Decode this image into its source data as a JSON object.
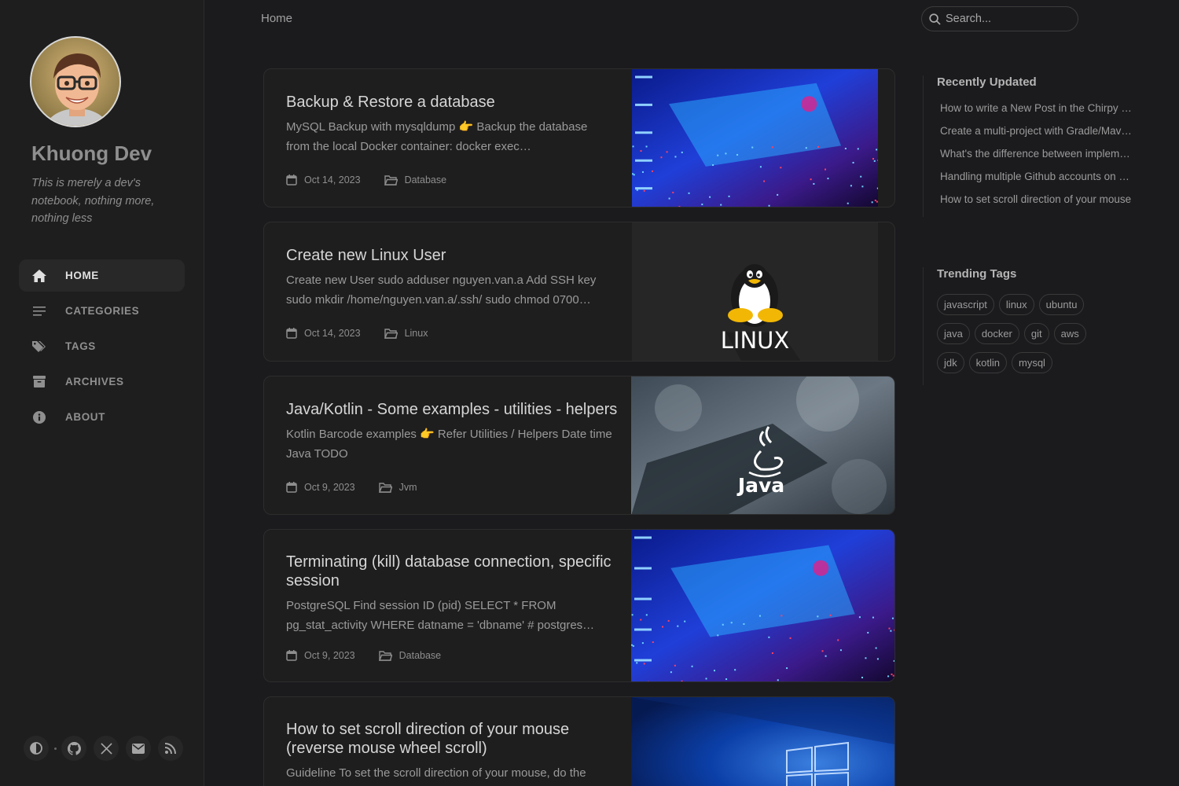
{
  "sidebar": {
    "title": "Khuong Dev",
    "subtitle": "This is merely a dev's notebook, nothing more, nothing less",
    "nav": [
      {
        "label": "HOME",
        "icon": "home-icon"
      },
      {
        "label": "CATEGORIES",
        "icon": "list-icon"
      },
      {
        "label": "TAGS",
        "icon": "tags-icon"
      },
      {
        "label": "ARCHIVES",
        "icon": "archive-icon"
      },
      {
        "label": "ABOUT",
        "icon": "info-icon"
      }
    ],
    "bottom_icons": [
      "theme-toggle-icon",
      "github-icon",
      "x-twitter-icon",
      "email-icon",
      "rss-icon"
    ]
  },
  "topbar": {
    "breadcrumb": "Home",
    "search_placeholder": "Search..."
  },
  "posts": [
    {
      "title": "Backup & Restore a database",
      "excerpt": "MySQL Backup with mysqldump 👉 Backup the database from the local Docker container: docker exec…",
      "date": "Oct 14, 2023",
      "category": "Database",
      "image": "sql-image"
    },
    {
      "title": "Create new Linux User",
      "excerpt": "Create new User sudo adduser nguyen.van.a Add SSH key sudo mkdir /home/nguyen.van.a/.ssh/ sudo chmod 0700…",
      "date": "Oct 14, 2023",
      "category": "Linux",
      "image": "linux-image",
      "image_caption": "LINUX"
    },
    {
      "title": "Java/Kotlin - Some examples - utilities - helpers",
      "excerpt": "Kotlin Barcode examples 👉 Refer Utilities / Helpers Date time Java TODO",
      "date": "Oct 9, 2023",
      "category": "Jvm",
      "image": "java-image",
      "image_caption": "Java"
    },
    {
      "title": "Terminating (kill) database connection, specific session",
      "excerpt": "PostgreSQL Find session ID (pid) SELECT * FROM pg_stat_activity WHERE datname = 'dbname' # postgres…",
      "date": "Oct 9, 2023",
      "category": "Database",
      "image": "sql-image"
    },
    {
      "title": "How to set scroll direction of your mouse (reverse mouse wheel scroll)",
      "excerpt": "Guideline To set the scroll direction of your mouse, do the",
      "image": "windows-image"
    }
  ],
  "recently_updated": {
    "heading": "Recently Updated",
    "items": [
      "How to write a New Post in the Chirpy theme",
      "Create a multi-project with Gradle/Maven",
      "What's the difference between implementation and api",
      "Handling multiple Github accounts on one machine",
      "How to set scroll direction of your mouse"
    ]
  },
  "trending_tags": {
    "heading": "Trending Tags",
    "tags": [
      "javascript",
      "linux",
      "ubuntu",
      "java",
      "docker",
      "git",
      "aws",
      "jdk",
      "kotlin",
      "mysql"
    ]
  },
  "colors": {
    "background": "#1b1b1e",
    "sidebar": "#1e1e1e",
    "card": "#1e1e1e",
    "text": "#d6d6d6"
  }
}
